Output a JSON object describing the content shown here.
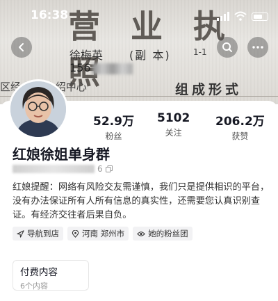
{
  "status_bar": {
    "time": "16:38"
  },
  "cover": {
    "title": "营 业 执 照",
    "name": "徐梅英",
    "copy_label": "(副 本)",
    "copy_number": "1-1",
    "reg_number_prefix": "156",
    "scope_text": "区经    婚姻介绍中心",
    "form_label": "组成形式"
  },
  "stats": [
    {
      "value": "52.9万",
      "label": "粉丝"
    },
    {
      "value": "5102",
      "label": "关注"
    },
    {
      "value": "206.2万",
      "label": "获赞"
    }
  ],
  "profile": {
    "nickname": "红娘徐姐单身群",
    "account_suffix": "6",
    "bio": "红娘提醒：网络有风险交友需谨慎，我们只是提供相识的平台，没有办法保证所有人所有信息的真实性，还需要您认真识别查证。有经济交往者后果自负。"
  },
  "tags": [
    {
      "icon": "navigation-icon",
      "label": "导航到店"
    },
    {
      "icon": "location-icon",
      "label": "河南 郑州市"
    },
    {
      "icon": "fan-group-icon",
      "label": "她的粉丝团"
    }
  ],
  "paid": {
    "title": "付费内容",
    "subtitle": "6个内容"
  }
}
